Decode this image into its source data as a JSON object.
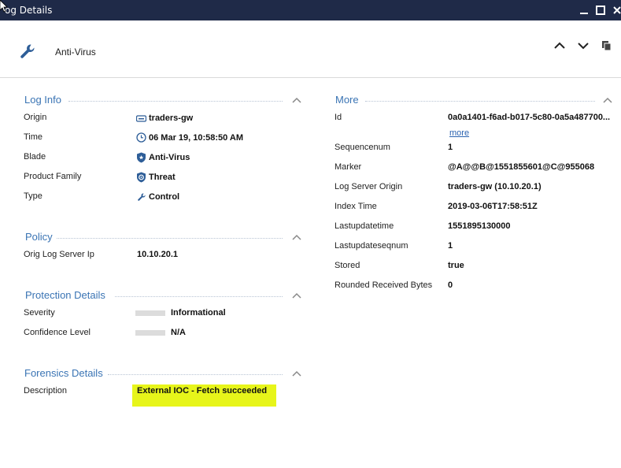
{
  "window": {
    "title": "Log Details",
    "title_visible": "og Details"
  },
  "header": {
    "title": "Anti-Virus"
  },
  "log_info": {
    "title": "Log Info",
    "rows": [
      {
        "label": "Origin",
        "value": "traders-gw",
        "icon": "gateway-icon"
      },
      {
        "label": "Time",
        "value": "06 Mar 19, 10:58:50 AM",
        "icon": "clock-icon"
      },
      {
        "label": "Blade",
        "value": "Anti-Virus",
        "icon": "shield-star-icon"
      },
      {
        "label": "Product Family",
        "value": "Threat",
        "icon": "threat-shield-icon"
      },
      {
        "label": "Type",
        "value": "Control",
        "icon": "wrench-icon"
      }
    ]
  },
  "policy": {
    "title": "Policy",
    "rows": [
      {
        "label": "Orig Log Server Ip",
        "value": "10.10.20.1"
      }
    ]
  },
  "protection_details": {
    "title": "Protection Details",
    "rows": [
      {
        "label": "Severity",
        "value": "Informational"
      },
      {
        "label": "Confidence Level",
        "value": "N/A"
      }
    ]
  },
  "forensics_details": {
    "title": "Forensics Details",
    "rows": [
      {
        "label": "Description",
        "value": "External IOC - Fetch succeeded"
      }
    ],
    "highlight_color": "#e7f51a"
  },
  "more": {
    "title": "More",
    "more_link": "more",
    "rows": [
      {
        "label": "Id",
        "value": "0a0a1401-f6ad-b017-5c80-0a5a487700..."
      },
      {
        "label": "Sequencenum",
        "value": "1"
      },
      {
        "label": "Marker",
        "value": "@A@@B@1551855601@C@955068"
      },
      {
        "label": "Log Server Origin",
        "value": "traders-gw (10.10.20.1)"
      },
      {
        "label": "Index Time",
        "value": "2019-03-06T17:58:51Z"
      },
      {
        "label": "Lastupdatetime",
        "value": "1551895130000"
      },
      {
        "label": "Lastupdateseqnum",
        "value": "1"
      },
      {
        "label": "Stored",
        "value": "true"
      },
      {
        "label": "Rounded Received Bytes",
        "value": "0"
      }
    ]
  },
  "colors": {
    "titlebar": "#1f2a48",
    "section_title": "#3a74b4",
    "link": "#2b63b0"
  }
}
